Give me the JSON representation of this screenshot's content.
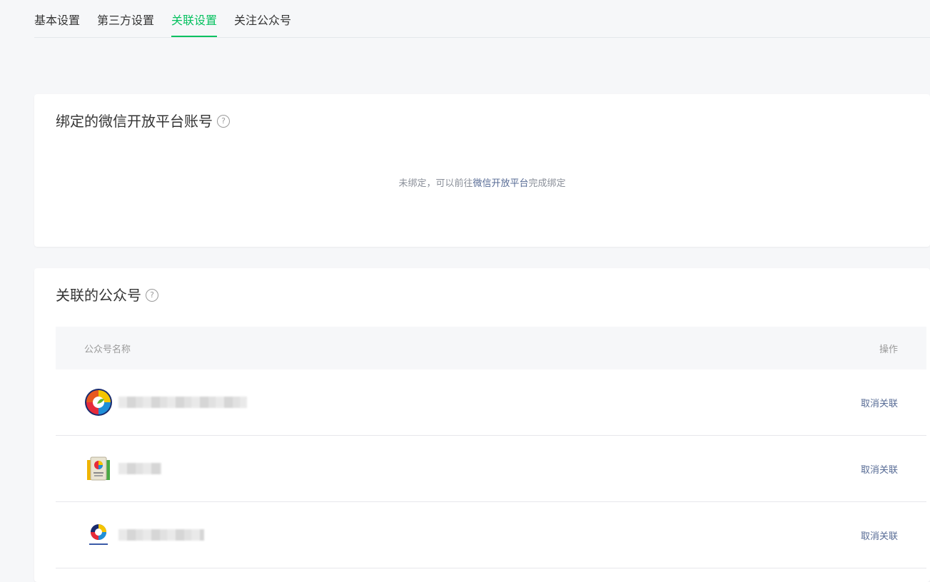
{
  "tabs": [
    {
      "label": "基本设置",
      "active": false
    },
    {
      "label": "第三方设置",
      "active": false
    },
    {
      "label": "关联设置",
      "active": true
    },
    {
      "label": "关注公众号",
      "active": false
    }
  ],
  "open_platform": {
    "title": "绑定的微信开放平台账号",
    "empty_prefix": "未绑定，可以前往",
    "empty_link": "微信开放平台",
    "empty_suffix": "完成绑定"
  },
  "linked_accounts": {
    "title": "关联的公众号",
    "col_name": "公众号名称",
    "col_op": "操作",
    "rows": [
      {
        "avatar_icon": "rainbow-logo-icon",
        "name_blurred": true,
        "action": "取消关联"
      },
      {
        "avatar_icon": "book-logo-icon",
        "name_blurred": true,
        "action": "取消关联"
      },
      {
        "avatar_icon": "small-rainbow-logo-icon",
        "name_blurred": true,
        "action": "取消关联"
      }
    ]
  },
  "colors": {
    "accent": "#07c160",
    "link": "#576b95"
  }
}
